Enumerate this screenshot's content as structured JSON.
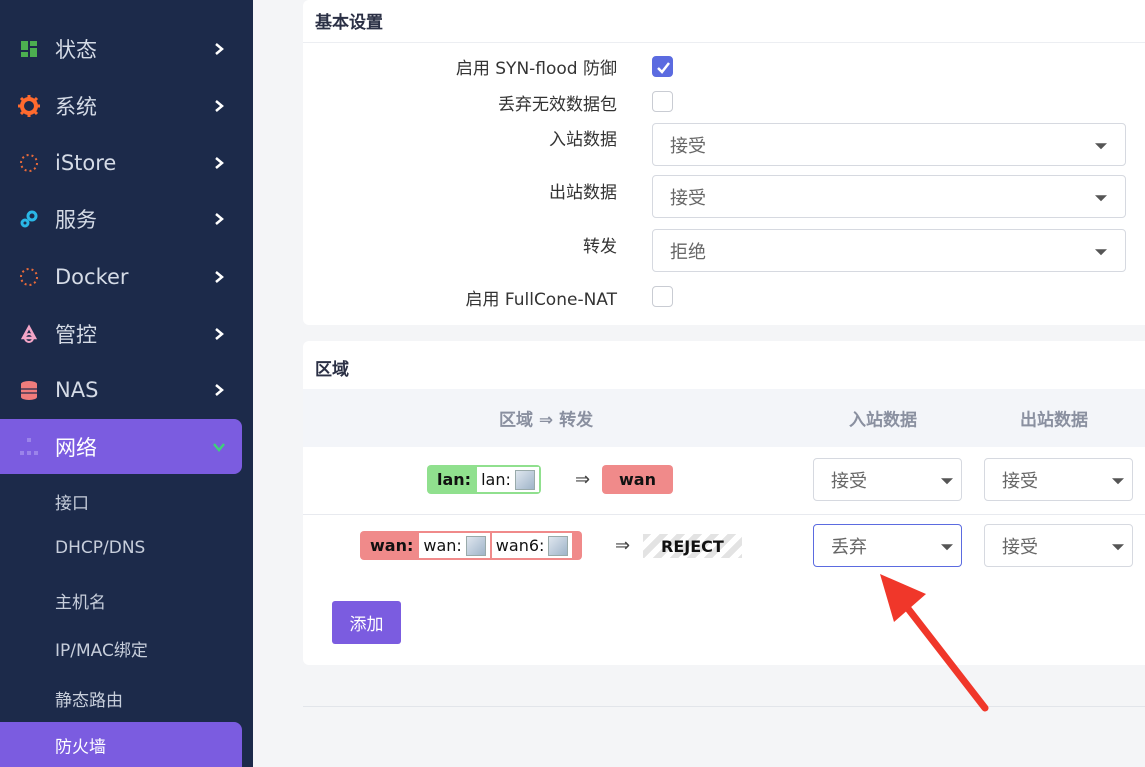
{
  "sidebar": {
    "items": [
      {
        "label": "状态",
        "icon": "status-icon"
      },
      {
        "label": "系统",
        "icon": "gear-icon"
      },
      {
        "label": "iStore",
        "icon": "spinner-icon"
      },
      {
        "label": "服务",
        "icon": "services-gear-icon"
      },
      {
        "label": "Docker",
        "icon": "spinner-icon"
      },
      {
        "label": "管控",
        "icon": "control-icon"
      },
      {
        "label": "NAS",
        "icon": "database-icon"
      },
      {
        "label": "网络",
        "icon": "network-icon"
      }
    ],
    "subitems": [
      "接口",
      "DHCP/DNS",
      "主机名",
      "IP/MAC绑定",
      "静态路由",
      "防火墙"
    ]
  },
  "basic": {
    "title": "基本设置",
    "syn_label": "启用 SYN-flood 防御",
    "drop_label": "丢弃无效数据包",
    "input_label": "入站数据",
    "input_value": "接受",
    "output_label": "出站数据",
    "output_value": "接受",
    "forward_label": "转发",
    "forward_value": "拒绝",
    "fullcone_label": "启用 FullCone-NAT"
  },
  "zones": {
    "title": "区域",
    "col_zone": "区域 ⇒ 转发",
    "col_input": "入站数据",
    "col_output": "出站数据",
    "arrow": "⇒",
    "rows": [
      {
        "zone": "lan:",
        "chips": [
          "lan:"
        ],
        "target": "wan",
        "input": "接受",
        "output": "接受"
      },
      {
        "zone": "wan:",
        "chips": [
          "wan:",
          "wan6:"
        ],
        "target": "REJECT",
        "input": "丢弃",
        "output": "接受"
      }
    ],
    "add_label": "添加"
  },
  "colors": {
    "sidebar_bg": "#1c2a4a",
    "accent": "#7b5ce0",
    "lan_green": "#90e08e",
    "wan_red": "#f08a8a",
    "annotation_arrow": "#f0372a"
  }
}
